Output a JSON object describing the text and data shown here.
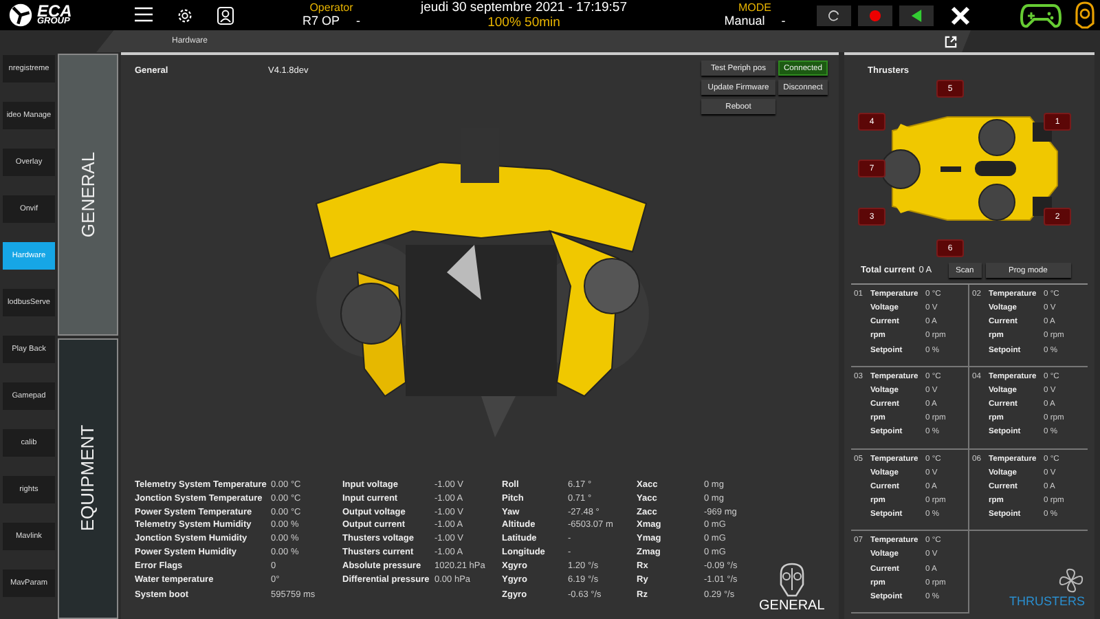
{
  "header": {
    "logo_top": "ECA",
    "logo_bottom": "GROUP",
    "operator_label": "Operator",
    "operator_value": "R7 OP",
    "operator_caret": "-",
    "datetime": "jeudi 30 septembre 2021 - 17:19:57",
    "battery": "100% 50min",
    "mode_label": "MODE",
    "mode_value": "Manual",
    "mode_caret": "-"
  },
  "breadcrumb": "Hardware",
  "sidebar": {
    "items": [
      {
        "label": "nregistreme",
        "selected": false
      },
      {
        "label": "ideo Manage",
        "selected": false
      },
      {
        "label": "Overlay",
        "selected": false
      },
      {
        "label": "Onvif",
        "selected": false
      },
      {
        "label": "Hardware",
        "selected": true
      },
      {
        "label": "lodbusServe",
        "selected": false
      },
      {
        "label": "Play Back",
        "selected": false
      },
      {
        "label": "Gamepad",
        "selected": false
      },
      {
        "label": "calib",
        "selected": false
      },
      {
        "label": "rights",
        "selected": false
      },
      {
        "label": "Mavlink",
        "selected": false
      },
      {
        "label": "MavParam",
        "selected": false
      }
    ]
  },
  "tabs": [
    {
      "label": "GENERAL",
      "selected": true
    },
    {
      "label": "EQUIPMENT",
      "selected": false
    }
  ],
  "general": {
    "title": "General",
    "version": "V4.1.8dev",
    "buttons": [
      {
        "label": "Test Periph pos"
      },
      {
        "label": "Update Firmware"
      },
      {
        "label": "Reboot"
      }
    ],
    "connection": [
      {
        "label": "Connected",
        "on": true
      },
      {
        "label": "Disconnect",
        "on": false
      }
    ],
    "telemetry": [
      [
        {
          "label": "Telemetry System Temperature",
          "value": "0.00 °C"
        },
        {
          "label": "Jonction System Temperature",
          "value": "0.00 °C"
        },
        {
          "label": "Power System Temperature",
          "value": "0.00 °C"
        },
        {
          "label": "Telemetry System Humidity",
          "value": "0.00 %"
        },
        {
          "label": "Jonction System Humidity",
          "value": "0.00 %"
        },
        {
          "label": "Power System Humidity",
          "value": "0.00 %"
        },
        {
          "label": "Error Flags",
          "value": "0"
        },
        {
          "label": "Water temperature",
          "value": "0°"
        },
        {
          "label": "System boot",
          "value": "595759 ms"
        }
      ],
      [
        {
          "label": "Input voltage",
          "value": "-1.00 V"
        },
        {
          "label": "Input current",
          "value": "-1.00 A"
        },
        {
          "label": "Output voltage",
          "value": "-1.00 V"
        },
        {
          "label": "Output current",
          "value": "-1.00 A"
        },
        {
          "label": "Thusters voltage",
          "value": "-1.00 V"
        },
        {
          "label": "Thusters current",
          "value": "-1.00 A"
        },
        {
          "label": "Absolute pressure",
          "value": "1020.21 hPa"
        },
        {
          "label": "Differential pressure",
          "value": "0.00 hPa"
        }
      ],
      [
        {
          "label": "Roll",
          "value": "6.17 °"
        },
        {
          "label": "Pitch",
          "value": "0.71 °"
        },
        {
          "label": "Yaw",
          "value": "-27.48 °"
        },
        {
          "label": "Altitude",
          "value": "-6503.07 m"
        },
        {
          "label": "Latitude",
          "value": "-"
        },
        {
          "label": "Longitude",
          "value": "-"
        },
        {
          "label": "Xgyro",
          "value": "1.20 °/s"
        },
        {
          "label": "Ygyro",
          "value": "6.19 °/s"
        },
        {
          "label": "Zgyro",
          "value": "-0.63 °/s"
        }
      ],
      [
        {
          "label": "Xacc",
          "value": "0 mg"
        },
        {
          "label": "Yacc",
          "value": "0 mg"
        },
        {
          "label": "Zacc",
          "value": "-969 mg"
        },
        {
          "label": "Xmag",
          "value": "0 mG"
        },
        {
          "label": "Ymag",
          "value": "0 mG"
        },
        {
          "label": "Zmag",
          "value": "0 mG"
        },
        {
          "label": "Rx",
          "value": "-0.09 °/s"
        },
        {
          "label": "Ry",
          "value": "-1.01 °/s"
        },
        {
          "label": "Rz",
          "value": "0.29 °/s"
        }
      ]
    ],
    "footer": "GENERAL"
  },
  "thrusters": {
    "title": "Thrusters",
    "badges": [
      "5",
      "4",
      "1",
      "7",
      "3",
      "2",
      "6"
    ],
    "total_label": "Total current",
    "total_value": "0 A",
    "buttons": [
      {
        "label": "Scan"
      },
      {
        "label": "Prog mode"
      }
    ],
    "units": [
      {
        "id": "01",
        "rows": [
          {
            "label": "Temperature",
            "value": "0 °C"
          },
          {
            "label": "Voltage",
            "value": "0 V"
          },
          {
            "label": "Current",
            "value": "0 A"
          },
          {
            "label": "rpm",
            "value": "0 rpm"
          },
          {
            "label": "Setpoint",
            "value": "0 %"
          }
        ]
      },
      {
        "id": "02",
        "rows": [
          {
            "label": "Temperature",
            "value": "0 °C"
          },
          {
            "label": "Voltage",
            "value": "0 V"
          },
          {
            "label": "Current",
            "value": "0 A"
          },
          {
            "label": "rpm",
            "value": "0 rpm"
          },
          {
            "label": "Setpoint",
            "value": "0 %"
          }
        ]
      },
      {
        "id": "03",
        "rows": [
          {
            "label": "Temperature",
            "value": "0 °C"
          },
          {
            "label": "Voltage",
            "value": "0 V"
          },
          {
            "label": "Current",
            "value": "0 A"
          },
          {
            "label": "rpm",
            "value": "0 rpm"
          },
          {
            "label": "Setpoint",
            "value": "0 %"
          }
        ]
      },
      {
        "id": "04",
        "rows": [
          {
            "label": "Temperature",
            "value": "0 °C"
          },
          {
            "label": "Voltage",
            "value": "0 V"
          },
          {
            "label": "Current",
            "value": "0 A"
          },
          {
            "label": "rpm",
            "value": "0 rpm"
          },
          {
            "label": "Setpoint",
            "value": "0 %"
          }
        ]
      },
      {
        "id": "05",
        "rows": [
          {
            "label": "Temperature",
            "value": "0 °C"
          },
          {
            "label": "Voltage",
            "value": "0 V"
          },
          {
            "label": "Current",
            "value": "0 A"
          },
          {
            "label": "rpm",
            "value": "0 rpm"
          },
          {
            "label": "Setpoint",
            "value": "0 %"
          }
        ]
      },
      {
        "id": "06",
        "rows": [
          {
            "label": "Temperature",
            "value": "0 °C"
          },
          {
            "label": "Voltage",
            "value": "0 V"
          },
          {
            "label": "Current",
            "value": "0 A"
          },
          {
            "label": "rpm",
            "value": "0 rpm"
          },
          {
            "label": "Setpoint",
            "value": "0 %"
          }
        ]
      },
      {
        "id": "07",
        "rows": [
          {
            "label": "Temperature",
            "value": "0 °C"
          },
          {
            "label": "Voltage",
            "value": "0 V"
          },
          {
            "label": "Current",
            "value": "0 A"
          },
          {
            "label": "rpm",
            "value": "0 rpm"
          },
          {
            "label": "Setpoint",
            "value": "0 %"
          }
        ]
      }
    ],
    "footer": "THRUSTERS"
  }
}
